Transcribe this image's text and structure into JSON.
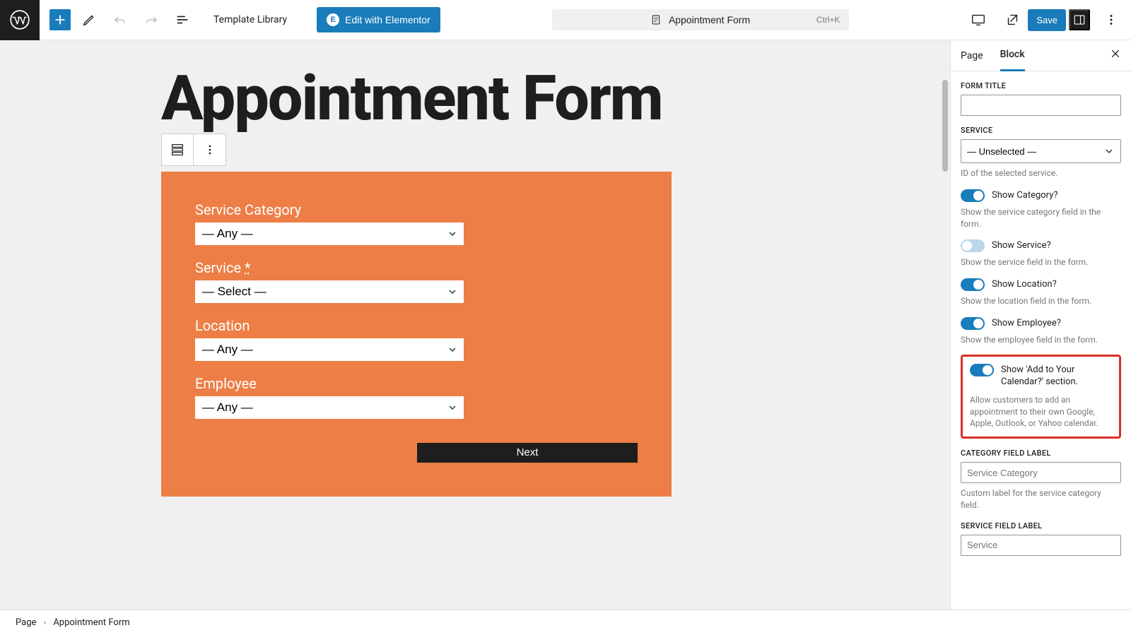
{
  "topbar": {
    "template_library": "Template Library",
    "elementor_btn": "Edit with Elementor",
    "doc_title": "Appointment Form",
    "shortcut": "Ctrl+K",
    "save": "Save"
  },
  "page": {
    "title": "Appointment Form"
  },
  "form": {
    "fields": {
      "category": {
        "label": "Service Category",
        "value": "— Any —"
      },
      "service": {
        "label": "Service",
        "required": "*",
        "value": "— Select —"
      },
      "location": {
        "label": "Location",
        "value": "— Any —"
      },
      "employee": {
        "label": "Employee",
        "value": "— Any —"
      }
    },
    "next": "Next"
  },
  "sidebar": {
    "tabs": {
      "page": "Page",
      "block": "Block"
    },
    "form_title_label": "FORM TITLE",
    "form_title_value": "",
    "service_label": "SERVICE",
    "service_value": "— Unselected —",
    "service_desc": "ID of the selected service.",
    "toggles": {
      "category": {
        "label": "Show Category?",
        "desc": "Show the service category field in the form."
      },
      "service": {
        "label": "Show Service?",
        "desc": "Show the service field in the form."
      },
      "location": {
        "label": "Show Location?",
        "desc": "Show the location field in the form."
      },
      "employee": {
        "label": "Show Employee?",
        "desc": "Show the employee field in the form."
      },
      "calendar": {
        "label": "Show 'Add to Your Calendar?' section.",
        "desc": "Allow customers to add an appointment to their own Google, Apple, Outlook, or Yahoo calendar."
      }
    },
    "category_field_label": "CATEGORY FIELD LABEL",
    "category_field_placeholder": "Service Category",
    "category_field_desc": "Custom label for the service category field.",
    "service_field_label": "SERVICE FIELD LABEL",
    "service_field_placeholder": "Service"
  },
  "footer": {
    "root": "Page",
    "current": "Appointment Form"
  }
}
